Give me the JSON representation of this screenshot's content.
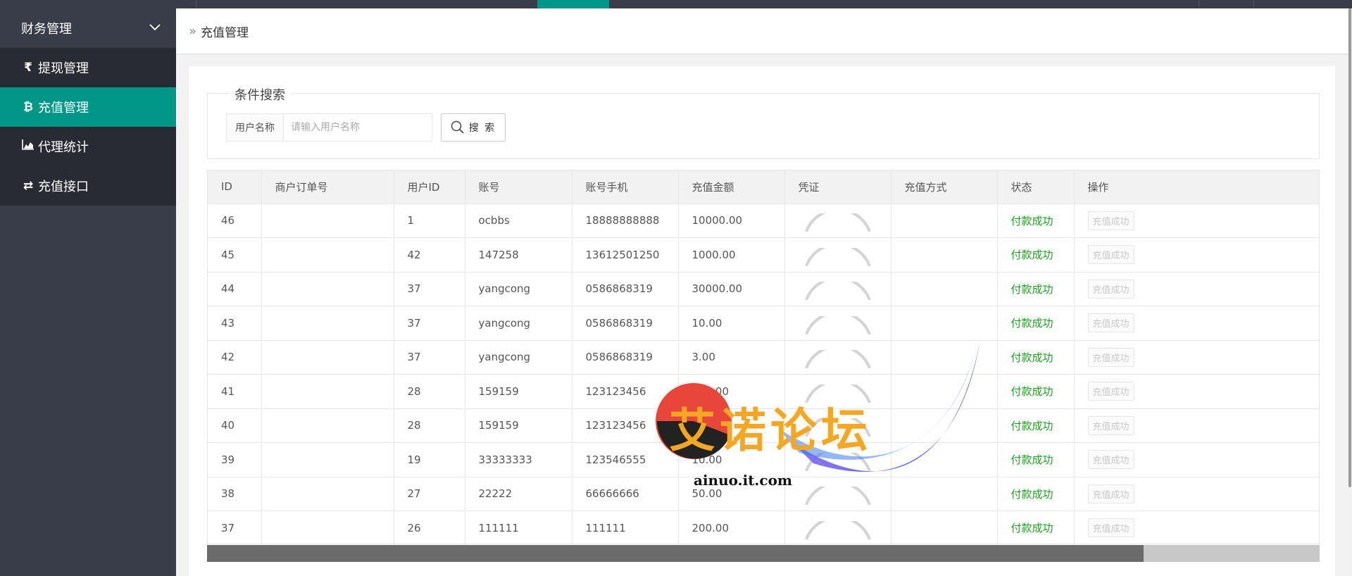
{
  "sidebar": {
    "group_label": "财务管理",
    "items": [
      {
        "icon": "rupee-icon",
        "glyph": "₹",
        "label": "提现管理",
        "active": false
      },
      {
        "icon": "bitcoin-icon",
        "glyph": "₿",
        "label": "充值管理",
        "active": true
      },
      {
        "icon": "area-chart-icon",
        "glyph": "",
        "label": "代理统计",
        "active": false
      },
      {
        "icon": "exchange-icon",
        "glyph": "⇄",
        "label": "充值接口",
        "active": false
      }
    ]
  },
  "breadcrumb": {
    "separator": "»",
    "title": "充值管理"
  },
  "search": {
    "legend": "条件搜索",
    "label": "用户名称",
    "placeholder": "请输入用户名称",
    "value": "",
    "button_label": "搜 索"
  },
  "table": {
    "columns": [
      "ID",
      "商户订单号",
      "用户ID",
      "账号",
      "账号手机",
      "充值金额",
      "凭证",
      "充值方式",
      "状态",
      "操作"
    ],
    "rows": [
      {
        "id": "46",
        "order": "",
        "uid": "1",
        "account": "ocbbs",
        "phone": "18888888888",
        "amount": "10000.00",
        "method": "",
        "status": "付款成功",
        "action": "充值成功"
      },
      {
        "id": "45",
        "order": "",
        "uid": "42",
        "account": "147258",
        "phone": "13612501250",
        "amount": "1000.00",
        "method": "",
        "status": "付款成功",
        "action": "充值成功"
      },
      {
        "id": "44",
        "order": "",
        "uid": "37",
        "account": "yangcong",
        "phone": "0586868319",
        "amount": "30000.00",
        "method": "",
        "status": "付款成功",
        "action": "充值成功"
      },
      {
        "id": "43",
        "order": "",
        "uid": "37",
        "account": "yangcong",
        "phone": "0586868319",
        "amount": "10.00",
        "method": "",
        "status": "付款成功",
        "action": "充值成功"
      },
      {
        "id": "42",
        "order": "",
        "uid": "37",
        "account": "yangcong",
        "phone": "0586868319",
        "amount": "3.00",
        "method": "",
        "status": "付款成功",
        "action": "充值成功"
      },
      {
        "id": "41",
        "order": "",
        "uid": "28",
        "account": "159159",
        "phone": "123123456",
        "amount": "200.00",
        "method": "",
        "status": "付款成功",
        "action": "充值成功"
      },
      {
        "id": "40",
        "order": "",
        "uid": "28",
        "account": "159159",
        "phone": "123123456",
        "amount": "200.00",
        "method": "",
        "status": "付款成功",
        "action": "充值成功"
      },
      {
        "id": "39",
        "order": "",
        "uid": "19",
        "account": "33333333",
        "phone": "123546555",
        "amount": "10.00",
        "method": "",
        "status": "付款成功",
        "action": "充值成功"
      },
      {
        "id": "38",
        "order": "",
        "uid": "27",
        "account": "22222",
        "phone": "66666666",
        "amount": "50.00",
        "method": "",
        "status": "付款成功",
        "action": "充值成功"
      },
      {
        "id": "37",
        "order": "",
        "uid": "26",
        "account": "111111",
        "phone": "111111",
        "amount": "200.00",
        "method": "",
        "status": "付款成功",
        "action": "充值成功"
      }
    ]
  },
  "watermark": {
    "title": "艾诺论坛",
    "url": "ainuo.it.com"
  },
  "colors": {
    "accent": "#009688",
    "sidebar": "#393d49",
    "success": "#1aa01a"
  }
}
